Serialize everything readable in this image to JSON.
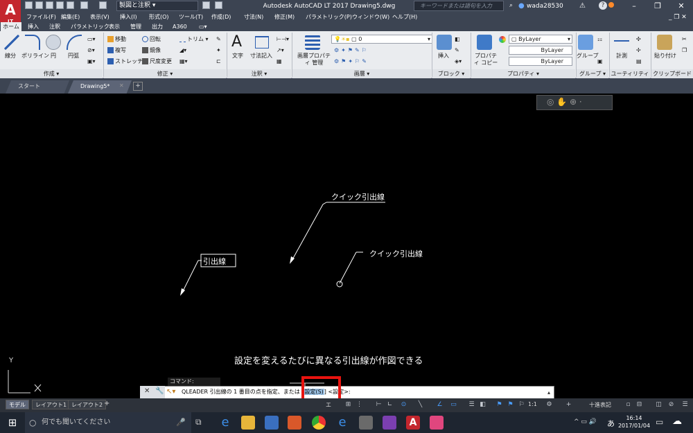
{
  "app": {
    "logo": "A",
    "logo_sub": "LT",
    "workspace": "製図と注釈",
    "title": "Autodesk AutoCAD LT 2017    Drawing5.dwg",
    "search_placeholder": "キーワードまたは語句を入力",
    "user": "wada28530"
  },
  "menus": [
    "ファイル(F)",
    "編集(E)",
    "表示(V)",
    "挿入(I)",
    "形式(O)",
    "ツール(T)",
    "作成(D)",
    "寸法(N)",
    "修正(M)",
    "パラメトリック(P)",
    "ウィンドウ(W)",
    "ヘルプ(H)"
  ],
  "ribbon_tabs": [
    "ホーム",
    "挿入",
    "注釈",
    "パラメトリック",
    "表示",
    "管理",
    "出力",
    "A360"
  ],
  "ribbon": {
    "draw": {
      "line": "線分",
      "polyline": "ポリライン",
      "circle": "円",
      "arc": "円弧",
      "panel": "作成 ▾"
    },
    "modify": {
      "move": "移動",
      "rotate": "回転",
      "trim": "トリム ▾",
      "copy": "複写",
      "mirror": "鏡像",
      "stretch": "ストレッチ",
      "scale": "尺度変更",
      "panel": "修正 ▾"
    },
    "annotation": {
      "text": "文字",
      "dimension": "寸法記入",
      "panel": "注釈 ▾"
    },
    "layers": {
      "props": "画層プロパティ 管理",
      "current": "0",
      "panel": "画層 ▾"
    },
    "block": {
      "insert": "挿入",
      "panel": "ブロック ▾"
    },
    "properties": {
      "copy": "プロパティ コピー",
      "bylayer1": "ByLayer",
      "bylayer2": "ByLayer",
      "bylayer3": "ByLayer",
      "panel": "プロパティ ▾"
    },
    "groups": {
      "group": "グループ",
      "panel": "グループ ▾"
    },
    "utilities": {
      "measure": "計測",
      "panel": "ユーティリティ ▾"
    },
    "clipboard": {
      "paste": "貼り付け",
      "panel": "クリップボード"
    }
  },
  "doc_tabs": [
    "スタート",
    "Drawing5*"
  ],
  "drawing": {
    "leader1": "クイック引出線",
    "leader2": "クイック引出線",
    "leader3": "引出線",
    "caption": "設定を変えるたびに異なる引出線が作図できる",
    "axis_y": "Y"
  },
  "command": {
    "history": "コマンド: QLEADER",
    "prefix": "QLEADER 引出線の 1 番目の点を指定、または",
    "option": "設定(S)",
    "suffix": "<設定>:"
  },
  "model_tabs": [
    "モデル",
    "レイアウト1",
    "レイアウト2"
  ],
  "status": {
    "paper": "エ",
    "scale": "1:1",
    "units": "十進表記"
  },
  "taskbar": {
    "search": "何でも聞いてください",
    "time": "16:14",
    "date": "2017/01/04",
    "ime": "あ"
  },
  "colors": {
    "accent": "#c4262e",
    "highlight": "#e8130f",
    "ribbon_bg": "#eaecef",
    "canvas": "#000000"
  }
}
